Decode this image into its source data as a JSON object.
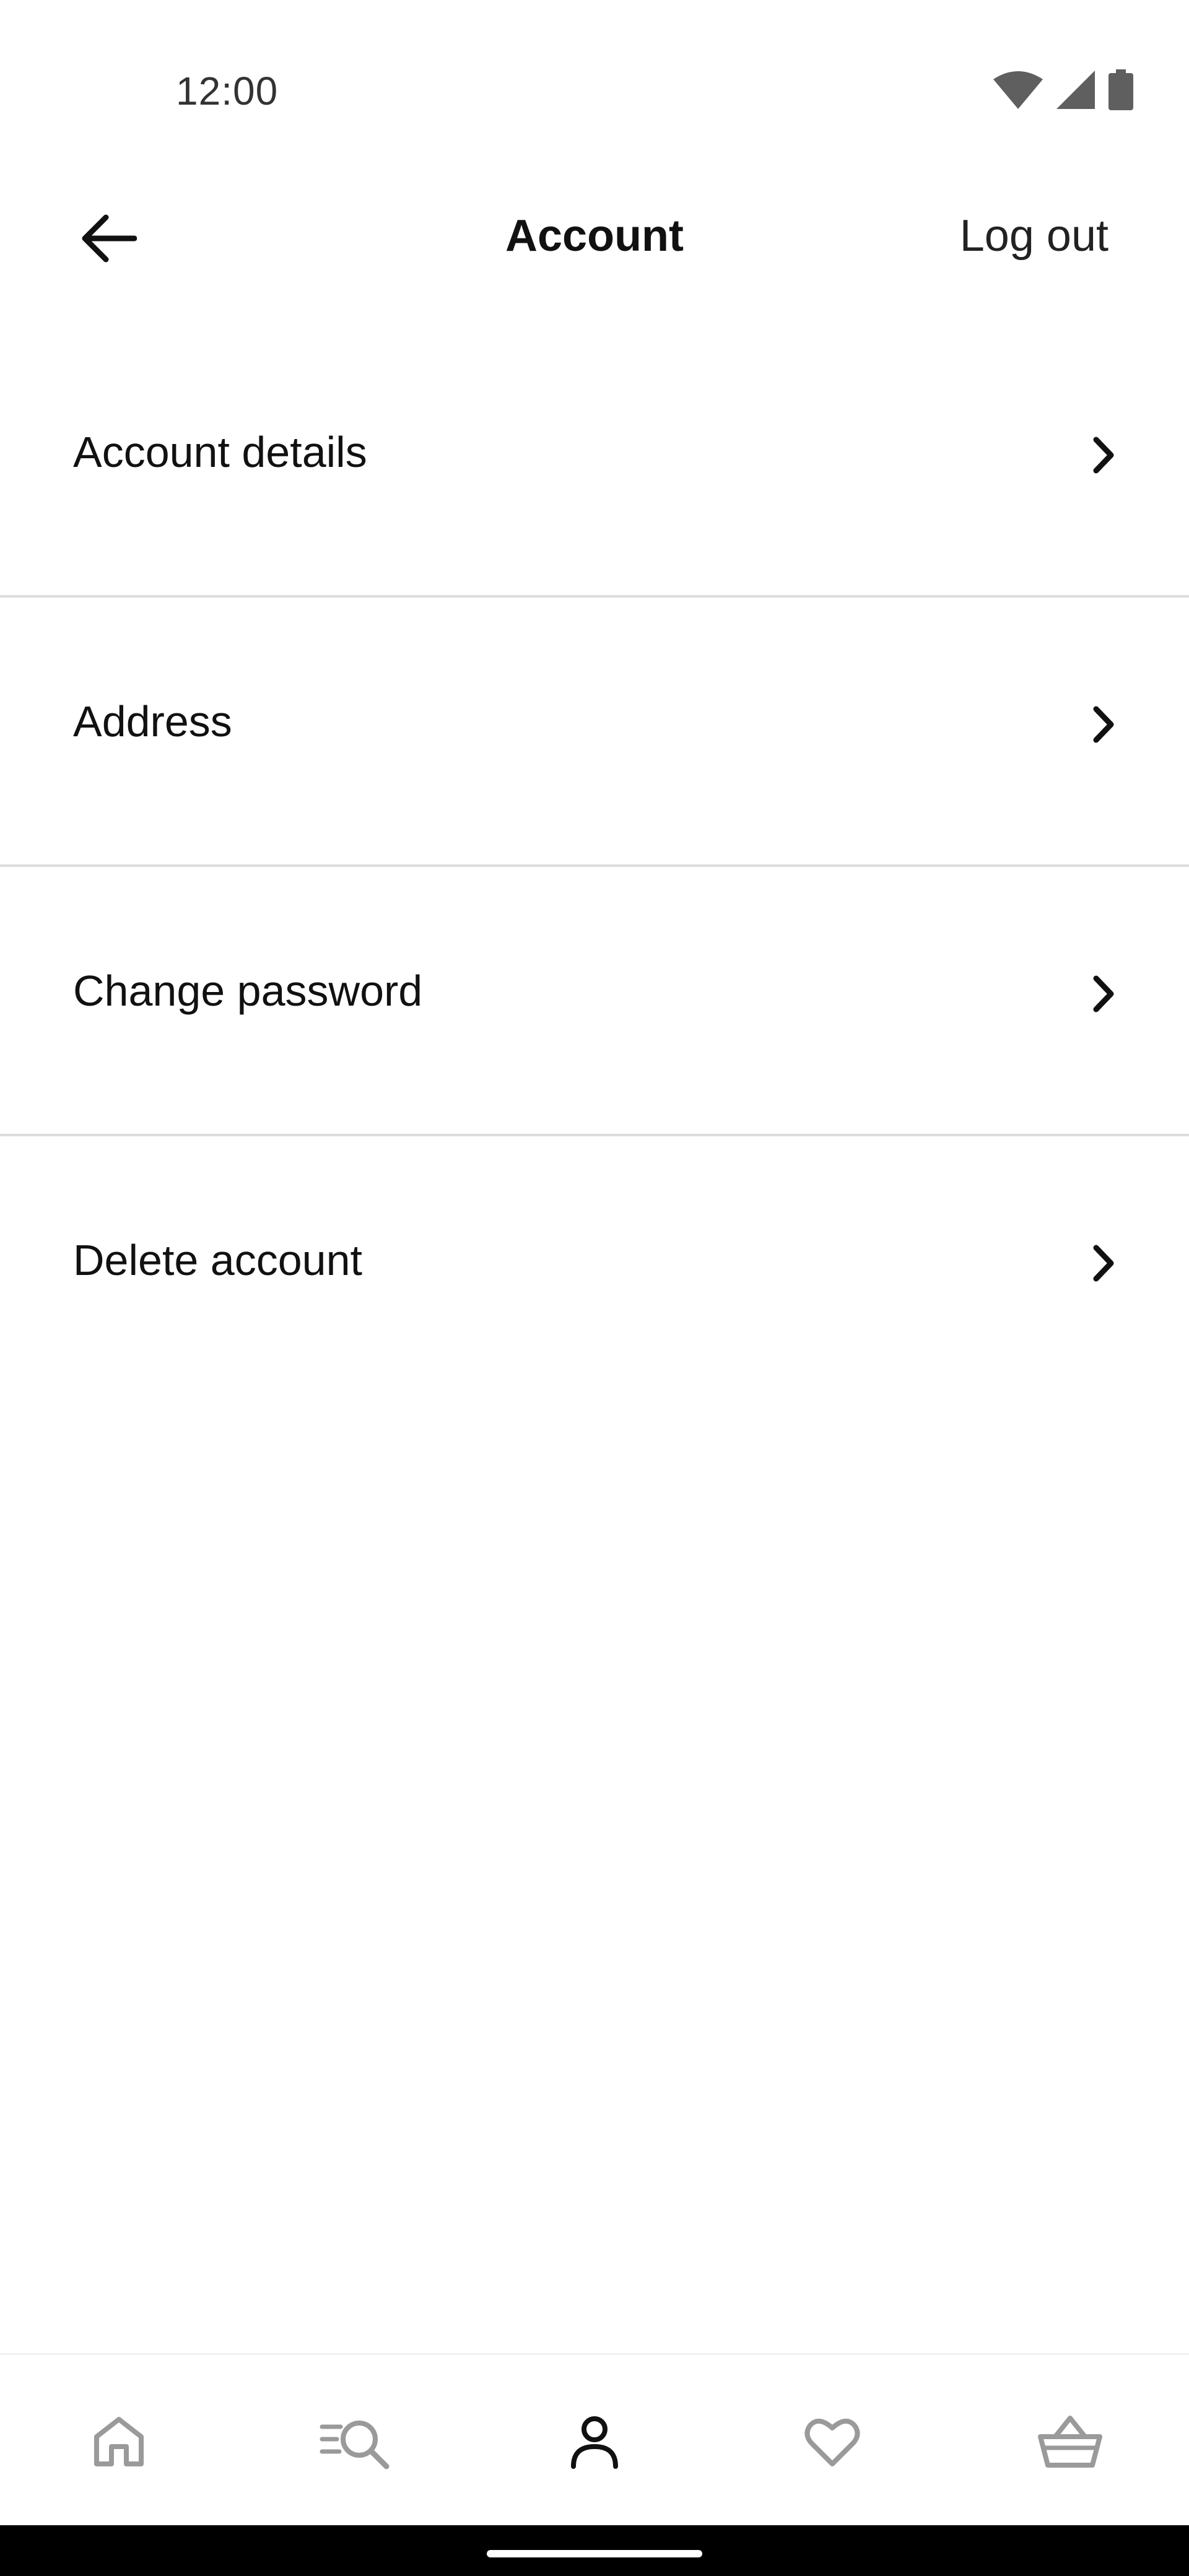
{
  "status_bar": {
    "time": "12:00",
    "icons": [
      "wifi-icon",
      "signal-icon",
      "battery-icon"
    ]
  },
  "app_bar": {
    "title": "Account",
    "logout_label": "Log out",
    "back_icon": "arrow-left-icon"
  },
  "menu": {
    "items": [
      {
        "label": "Account details",
        "icon": "chevron-right-icon"
      },
      {
        "label": "Address",
        "icon": "chevron-right-icon"
      },
      {
        "label": "Change password",
        "icon": "chevron-right-icon"
      },
      {
        "label": "Delete account",
        "icon": "chevron-right-icon"
      }
    ]
  },
  "bottom_nav": {
    "items": [
      {
        "icon": "home-icon",
        "active": false
      },
      {
        "icon": "search-icon",
        "active": false
      },
      {
        "icon": "profile-icon",
        "active": true
      },
      {
        "icon": "heart-icon",
        "active": false
      },
      {
        "icon": "basket-icon",
        "active": false
      }
    ]
  },
  "colors": {
    "active_icon": "#111111",
    "inactive_icon": "#9a9a9a",
    "divider": "#dcdcdc",
    "background": "#ffffff"
  }
}
